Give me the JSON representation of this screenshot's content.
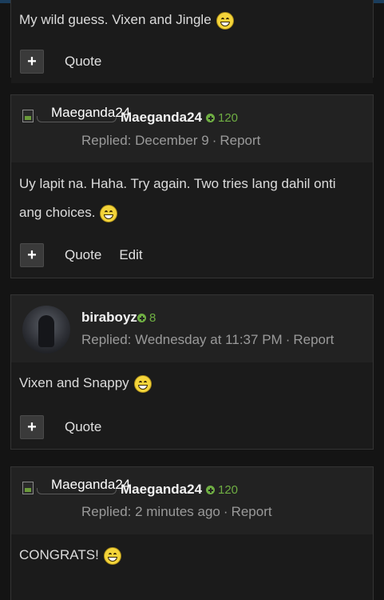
{
  "posts": [
    {
      "message": "My wild guess. Vixen and Jingle",
      "actions": {
        "plus": "+",
        "quote": "Quote"
      }
    },
    {
      "author": {
        "alt": "Maeganda24",
        "name": "Maeganda24",
        "rep": "120"
      },
      "meta": {
        "replied": "Replied: December 9",
        "sep": "·",
        "report": "Report"
      },
      "message_line1": "Uy lapit na. Haha. Try again. Two tries lang dahil onti",
      "message_line2": "ang choices.",
      "actions": {
        "plus": "+",
        "quote": "Quote",
        "edit": "Edit"
      }
    },
    {
      "author": {
        "name": "biraboyz",
        "rep": "8"
      },
      "meta": {
        "replied": "Replied: Wednesday at 11:37 PM",
        "sep": "·",
        "report": "Report"
      },
      "message": "Vixen and Snappy",
      "actions": {
        "plus": "+",
        "quote": "Quote"
      }
    },
    {
      "author": {
        "alt": "Maeganda24",
        "name": "Maeganda24",
        "rep": "120"
      },
      "meta": {
        "replied": "Replied: 2 minutes ago",
        "sep": "·",
        "report": "Report"
      },
      "message": "CONGRATS!"
    }
  ],
  "colors": {
    "rep_green": "#6fae43",
    "background": "#141414",
    "card_header": "#222222"
  },
  "icons": [
    "plus-icon",
    "reputation-plus-icon",
    "grin-emoji-icon",
    "broken-image-icon"
  ]
}
